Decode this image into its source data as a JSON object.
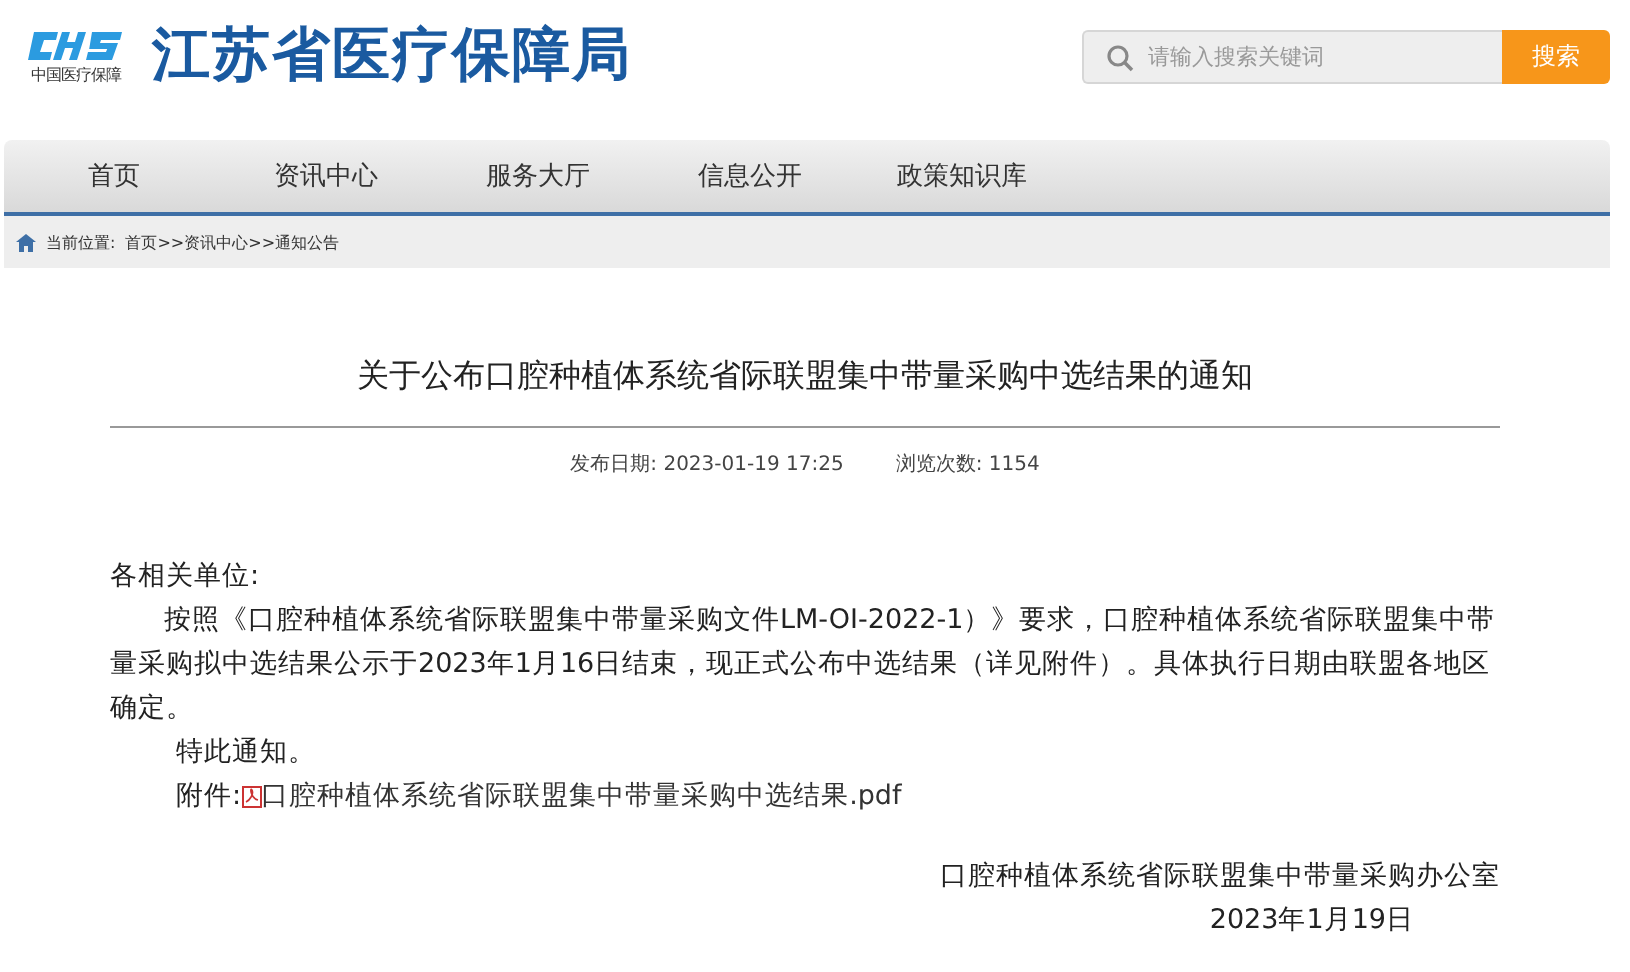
{
  "header": {
    "logo_caption": "中国医疗保障",
    "site_title": "江苏省医疗保障局",
    "search": {
      "placeholder": "请输入搜索关键词",
      "button": "搜索"
    }
  },
  "nav": [
    "首页",
    "资讯中心",
    "服务大厅",
    "信息公开",
    "政策知识库"
  ],
  "breadcrumb": {
    "label": "当前位置:",
    "path": "首页>>资讯中心>>通知公告"
  },
  "article": {
    "title": "关于公布口腔种植体系统省际联盟集中带量采购中选结果的通知",
    "meta": [
      {
        "label": "发布日期:",
        "value": "2023-01-19 17:25"
      },
      {
        "label": "浏览次数:",
        "value": "1154"
      }
    ],
    "salutation": "各相关单位:",
    "paragraph": "按照《口腔种植体系统省际联盟集中带量采购文件LM-OI-2022-1）》要求，口腔种植体系统省际联盟集中带量采购拟中选结果公示于2023年1月16日结束，现正式公布中选结果（详见附件）。具体执行日期由联盟各地区确定。",
    "closing": "特此通知。",
    "attachment": {
      "label": "附件:",
      "file": "口腔种植体系统省际联盟集中带量采购中选结果.pdf"
    },
    "signature": "口腔种植体系统省际联盟集中带量采购办公室",
    "date": "2023年1月19日"
  }
}
